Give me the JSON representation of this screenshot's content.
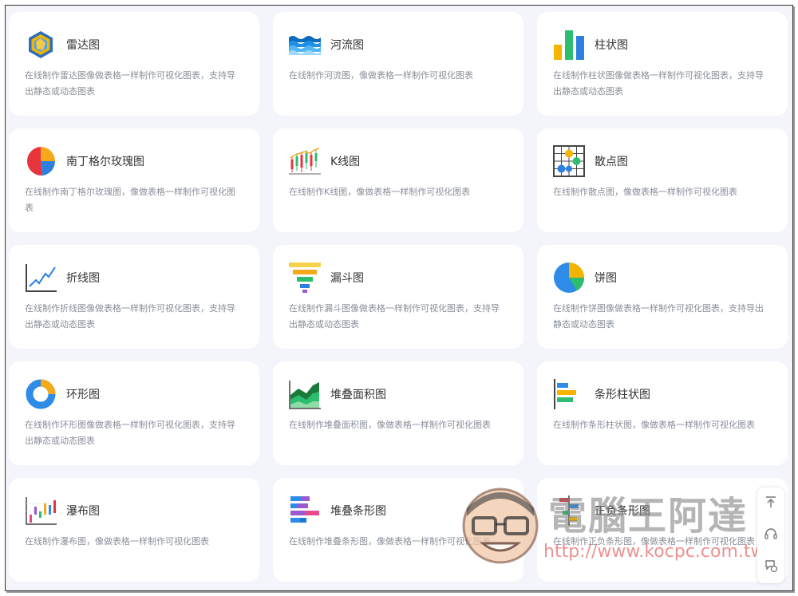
{
  "cards": [
    {
      "title": "雷达图",
      "desc": "在线制作雷达图像做表格一样制作可视化图表，支持导出静态或动态图表",
      "icon": "radar-chart-icon"
    },
    {
      "title": "河流图",
      "desc": "在线制作河流图，像做表格一样制作可视化图表",
      "icon": "river-chart-icon"
    },
    {
      "title": "柱状图",
      "desc": "在线制作柱状图像做表格一样制作可视化图表，支持导出静态或动态图表",
      "icon": "bar-chart-icon"
    },
    {
      "title": "南丁格尔玫瑰图",
      "desc": "在线制作南丁格尔玫瑰图，像做表格一样制作可视化图表",
      "icon": "rose-chart-icon"
    },
    {
      "title": "K线图",
      "desc": "在线制作K线图，像做表格一样制作可视化图表",
      "icon": "candlestick-chart-icon"
    },
    {
      "title": "散点图",
      "desc": "在线制作散点图，像做表格一样制作可视化图表",
      "icon": "scatter-chart-icon"
    },
    {
      "title": "折线图",
      "desc": "在线制作折线图像做表格一样制作可视化图表，支持导出静态或动态图表",
      "icon": "line-chart-icon"
    },
    {
      "title": "漏斗图",
      "desc": "在线制作漏斗图像做表格一样制作可视化图表，支持导出静态或动态图表",
      "icon": "funnel-chart-icon"
    },
    {
      "title": "饼图",
      "desc": "在线制作饼图像做表格一样制作可视化图表，支持导出静态或动态图表",
      "icon": "pie-chart-icon"
    },
    {
      "title": "环形图",
      "desc": "在线制作环形图像做表格一样制作可视化图表，支持导出静态或动态图表",
      "icon": "donut-chart-icon"
    },
    {
      "title": "堆叠面积图",
      "desc": "在线制作堆叠面积图，像做表格一样制作可视化图表",
      "icon": "stacked-area-chart-icon"
    },
    {
      "title": "条形柱状图",
      "desc": "在线制作条形柱状图，像做表格一样制作可视化图表",
      "icon": "horizontal-bar-chart-icon"
    },
    {
      "title": "瀑布图",
      "desc": "在线制作瀑布图，像做表格一样制作可视化图表",
      "icon": "waterfall-chart-icon"
    },
    {
      "title": "堆叠条形图",
      "desc": "在线制作堆叠条形图，像做表格一样制作可视化图表",
      "icon": "stacked-bar-chart-icon"
    },
    {
      "title": "正负条形图",
      "desc": "在线制作正负条形图，像做表格一样制作可视化图表",
      "icon": "diverging-bar-chart-icon"
    }
  ],
  "side_tools": [
    {
      "icon": "back-to-top-icon"
    },
    {
      "icon": "headset-icon"
    },
    {
      "icon": "feedback-icon"
    }
  ],
  "watermark": {
    "text": "電腦王阿達",
    "url": "http://www.kocpc.com.tw"
  },
  "colors": {
    "background": "#f4f5fb",
    "card": "#ffffff",
    "title": "#333333",
    "description": "#8a8f99"
  }
}
